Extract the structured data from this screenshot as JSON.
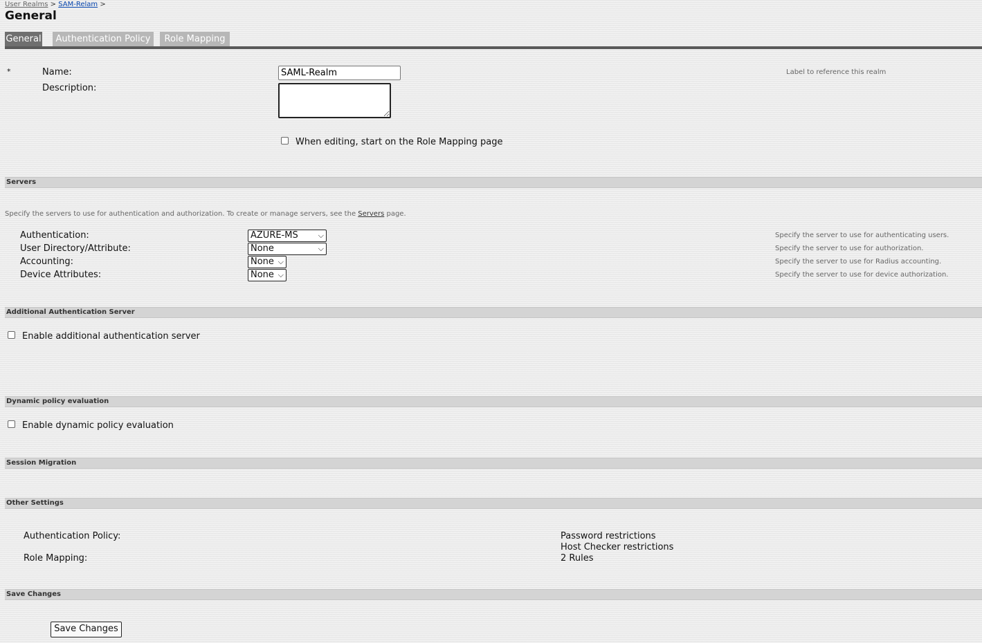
{
  "breadcrumb": {
    "root": "User Realms",
    "sep1": ">",
    "current": "SAM-Relam",
    "sep2": ">"
  },
  "page_title": "General",
  "tabs": [
    {
      "label": "General",
      "active": true
    },
    {
      "label": "Authentication Policy",
      "active": false
    },
    {
      "label": "Role Mapping",
      "active": false
    }
  ],
  "general": {
    "required_marker": "*",
    "name_label": "Name:",
    "name_value": "SAML-Realm",
    "name_hint": "Label to reference this realm",
    "description_label": "Description:",
    "description_value": "",
    "role_mapping_start_label": "When editing, start on the Role Mapping page",
    "role_mapping_start_checked": false
  },
  "servers": {
    "header": "Servers",
    "intro_before": "Specify the servers to use for authentication and authorization. To create or manage servers, see the",
    "intro_link": "Servers",
    "intro_after": "page.",
    "rows": [
      {
        "label": "Authentication:",
        "value": "AZURE-MS",
        "hint": "Specify the server to use for authenticating users."
      },
      {
        "label": "User Directory/Attribute:",
        "value": "None",
        "hint": "Specify the server to use for authorization."
      },
      {
        "label": "Accounting:",
        "value": "None",
        "hint": "Specify the server to use for Radius accounting."
      },
      {
        "label": "Device Attributes:",
        "value": "None",
        "hint": "Specify the server to use for device authorization."
      }
    ]
  },
  "additional_auth": {
    "header": "Additional Authentication Server",
    "checkbox_label": "Enable additional authentication server",
    "checked": false
  },
  "dynamic_policy": {
    "header": "Dynamic policy evaluation",
    "checkbox_label": "Enable dynamic policy evaluation",
    "checked": false
  },
  "session_migration": {
    "header": "Session Migration"
  },
  "other_settings": {
    "header": "Other Settings",
    "auth_policy_label": "Authentication Policy:",
    "auth_policy_values": [
      "Password restrictions",
      "Host Checker restrictions"
    ],
    "role_mapping_label": "Role Mapping:",
    "role_mapping_value": "2 Rules"
  },
  "save_section": {
    "header": "Save Changes",
    "button_label": "Save Changes"
  },
  "colors": {
    "tab_active": "#6f6f6f",
    "tab_inactive": "#b7b7b7",
    "section_bar": "#d4d4d4",
    "link": "#0645ad"
  }
}
